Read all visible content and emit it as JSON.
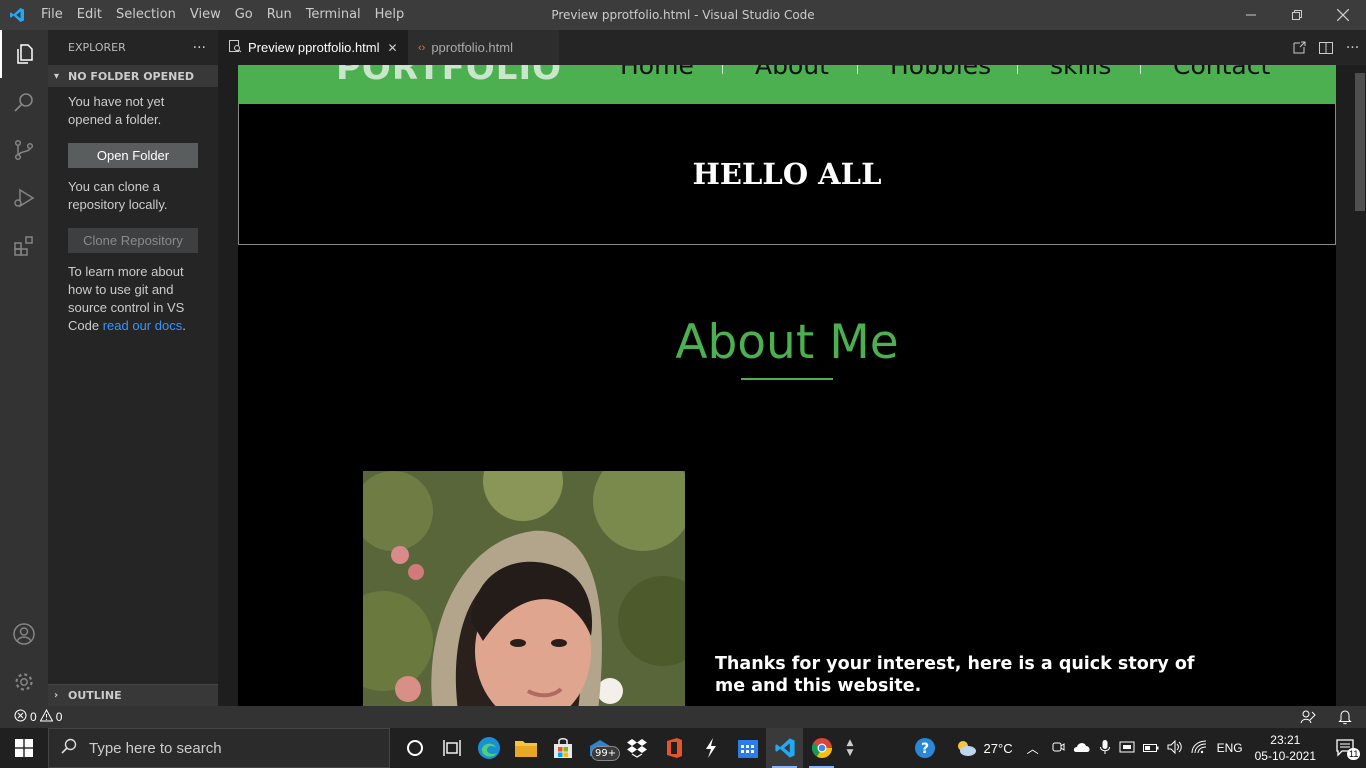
{
  "window": {
    "title": "Preview pprotfolio.html - Visual Studio Code"
  },
  "menu": [
    "File",
    "Edit",
    "Selection",
    "View",
    "Go",
    "Run",
    "Terminal",
    "Help"
  ],
  "explorer": {
    "title": "EXPLORER",
    "more": "···",
    "section": "NO FOLDER OPENED",
    "msg1": "You have not yet opened a folder.",
    "open_folder": "Open Folder",
    "msg2": "You can clone a repository locally.",
    "clone": "Clone Repository",
    "msg3_prefix": "To learn more about how to use git and source control in VS Code ",
    "msg3_link": "read our docs",
    "msg3_suffix": ".",
    "outline": "OUTLINE"
  },
  "tabs": [
    {
      "label": "Preview pprotfolio.html",
      "close": "✕"
    },
    {
      "label": "pprotfolio.html"
    }
  ],
  "preview": {
    "brand": "PORTFOLIO",
    "nav": [
      "Home",
      "About",
      "Hobbies",
      "skills",
      "Contact"
    ],
    "hello": "HELLO ALL",
    "about_title": "About Me",
    "story": "Thanks for your interest, here is a quick story of me and this website."
  },
  "status": {
    "errors": "0",
    "warnings": "0"
  },
  "taskbar": {
    "search_placeholder": "Type here to search",
    "badge": "99+",
    "temperature": "27°C",
    "lang": "ENG",
    "time": "23:21",
    "date": "05-10-2021",
    "notif_count": "11"
  },
  "colors": {
    "accent_green": "#4caf50",
    "vscode_blue": "#0078d4",
    "link": "#3794ff"
  }
}
